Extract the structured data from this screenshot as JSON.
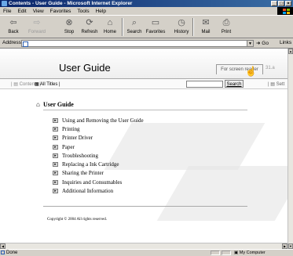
{
  "window": {
    "title": "Contents - User Guide - Microsoft Internet Explorer",
    "controls": [
      "_",
      "□",
      "×"
    ]
  },
  "menu": [
    "File",
    "Edit",
    "View",
    "Favorites",
    "Tools",
    "Help"
  ],
  "toolbar": {
    "back": "Back",
    "forward": "Forward",
    "stop": "Stop",
    "refresh": "Refresh",
    "home": "Home",
    "search": "Search",
    "favorites": "Favorites",
    "history": "History",
    "mail": "Mail",
    "print": "Print"
  },
  "address": {
    "label": "Address",
    "value": "",
    "go": "Go",
    "links": "Links"
  },
  "page": {
    "title": "User Guide",
    "screen_reader_tab": "For screen reader",
    "tab2_partial": "31.a",
    "nav_contents": "Contents",
    "nav_all_titles": "All Titles",
    "search_button": "Search",
    "nav_settings_partial": "Sett",
    "toc_heading": "User Guide",
    "toc_items": [
      "Using and Removing the User Guide",
      "Printing",
      "Printer Driver",
      "Paper",
      "Troubleshooting",
      "Replacing a Ink Cartridge",
      "Sharing the Printer",
      "Inquiries and Consumables",
      "Additional Information"
    ],
    "copyright": "Copyright © 2004 All rights reserved."
  },
  "status": {
    "text": "Done",
    "zone": "My Computer"
  }
}
